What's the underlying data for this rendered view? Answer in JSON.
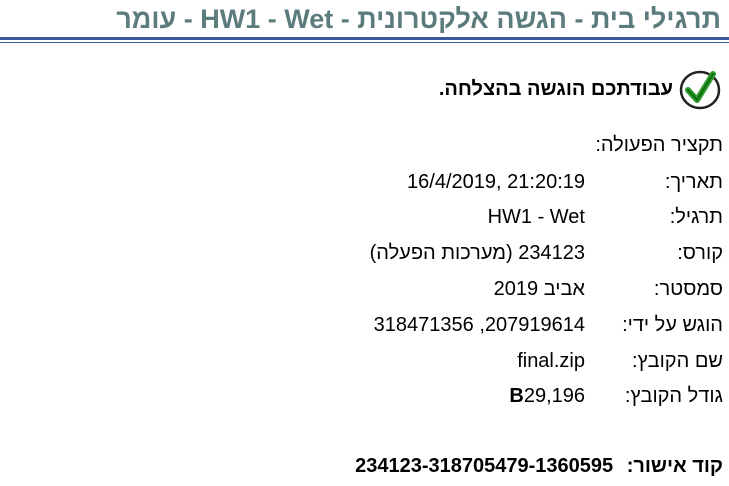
{
  "page_title": "תרגילי בית - הגשה אלקטרונית - HW1 - Wet - עומר",
  "success": {
    "icon": "check-circle-icon",
    "icon_color": "#2e9b2e",
    "message": "עבודתכם הוגשה בהצלחה."
  },
  "summary_title": "תקציר הפעולה:",
  "details": {
    "date": {
      "label": "תאריך:",
      "value": "21:20:19 ,16/4/2019"
    },
    "exercise": {
      "label": "תרגיל:",
      "value": "HW1 - Wet"
    },
    "course": {
      "label": "קורס:",
      "value": "234123 (מערכות הפעלה)"
    },
    "semester": {
      "label": "סמסטר:",
      "value": "אביב 2019"
    },
    "submitted_by": {
      "label": "הוגש על ידי:",
      "value": "207919614, 318471356"
    },
    "file_name": {
      "label": "שם הקובץ:",
      "value": "final.zip"
    },
    "file_size": {
      "label": "גודל הקובץ:",
      "value": "29,196",
      "unit": "B"
    }
  },
  "approval": {
    "label": "קוד אישור:",
    "value": "234123-318705479-1360595"
  },
  "colors": {
    "title": "#5b7b7d",
    "rule": "#3d5a9e"
  }
}
